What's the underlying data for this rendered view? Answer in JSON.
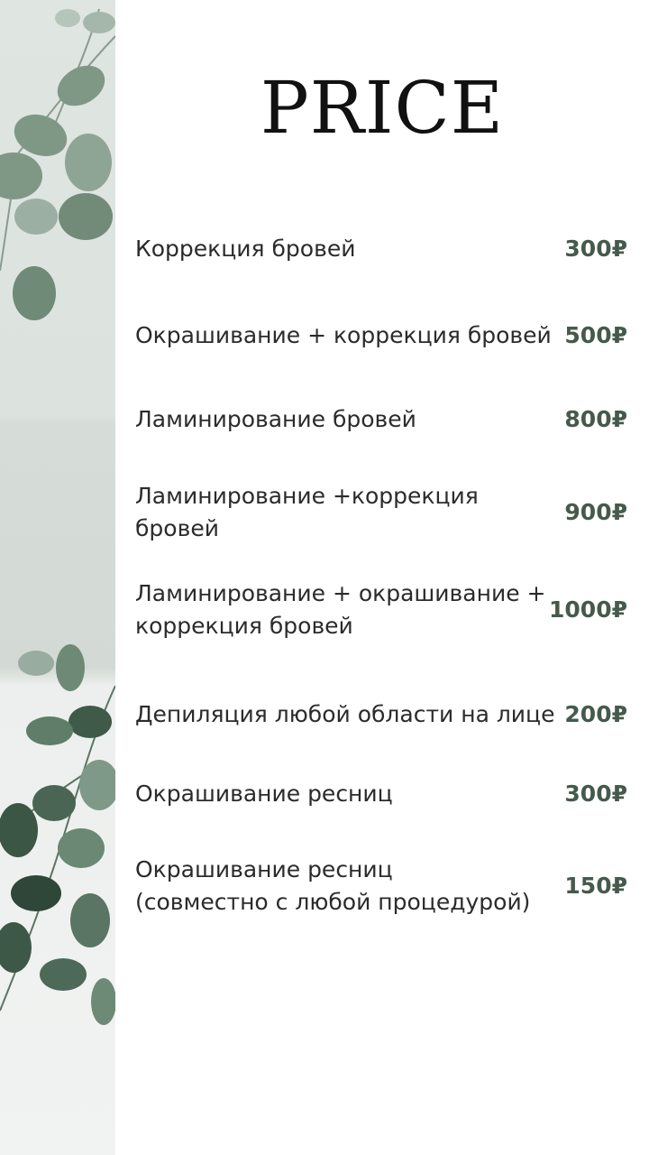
{
  "title": "PRICE",
  "colors": {
    "price": "#465a4c",
    "text": "#2b2b2b",
    "leaf": "#7b9482",
    "panel": "#dfe5e1"
  },
  "items": [
    {
      "label": "Коррекция бровей",
      "price": "300₽"
    },
    {
      "label": "Окрашивание + коррекция бровей",
      "price": "500₽"
    },
    {
      "label": "Ламинирование бровей",
      "price": "800₽"
    },
    {
      "label": "Ламинирование +коррекция бровей",
      "price": "900₽"
    },
    {
      "label": "Ламинирование + окрашивание +\nкоррекция бровей",
      "price": "1000₽"
    },
    {
      "label": "Депиляция любой области на лице",
      "price": "200₽"
    },
    {
      "label": "Окрашивание ресниц",
      "price": "300₽"
    },
    {
      "label": "Окрашивание ресниц\n(совместно с любой процедурой)",
      "price": "150₽"
    }
  ]
}
